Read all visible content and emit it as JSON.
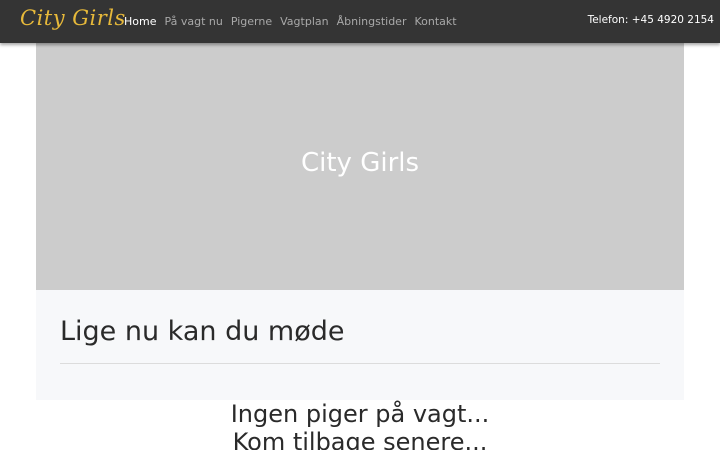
{
  "navbar": {
    "brand": "City Girls",
    "items": [
      {
        "label": "Home",
        "active": true
      },
      {
        "label": "På vagt nu",
        "active": false
      },
      {
        "label": "Pigerne",
        "active": false
      },
      {
        "label": "Vagtplan",
        "active": false
      },
      {
        "label": "Åbningstider",
        "active": false
      },
      {
        "label": "Kontakt",
        "active": false
      }
    ],
    "phone": "Telefon: +45 4920 2154"
  },
  "hero": {
    "title": "City Girls"
  },
  "panel": {
    "heading": "Lige nu kan du møde"
  },
  "empty_state": {
    "line1": "Ingen piger på vagt...",
    "line2": "Kom tilbage senere..."
  },
  "colors": {
    "navbar_bg": "#343434",
    "brand": "#e7b93a",
    "hero_bg": "#cccccc",
    "panel_bg": "#f7f8fa"
  }
}
